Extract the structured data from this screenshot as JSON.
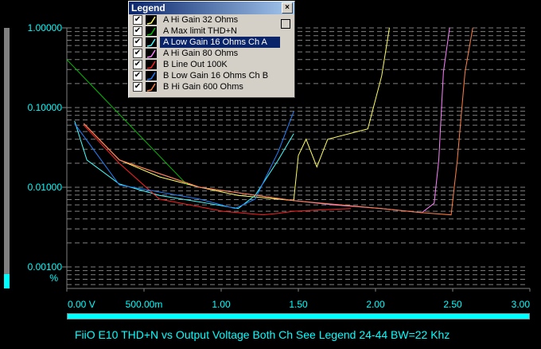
{
  "chart_data": {
    "type": "line",
    "title": "FiiO E10 THD+N vs Output Voltage Both Ch See Legend 24-44 BW=22 Khz",
    "xlabel": "V",
    "ylabel": "%",
    "xlim": [
      0,
      3
    ],
    "ylim": [
      0.00055,
      1
    ],
    "yscale": "log",
    "grid": true,
    "x_ticks": [
      "0.00 V",
      "500.00m",
      "1.00",
      "1.50",
      "2.00",
      "2.50",
      "3.00"
    ],
    "x_tick_values": [
      0,
      0.5,
      1,
      1.5,
      2,
      2.5,
      3
    ],
    "y_ticks": [
      "1.00000",
      "0.10000",
      "0.01000",
      "0.00100"
    ],
    "y_tick_values": [
      1,
      0.1,
      0.01,
      0.001
    ],
    "y_unit": "%",
    "series": [
      {
        "name": "A Hi Gain 32 Ohms",
        "color": "#ffff60",
        "points": [
          [
            0.11,
            0.063
          ],
          [
            0.34,
            0.022
          ],
          [
            0.6,
            0.0135
          ],
          [
            0.86,
            0.01
          ],
          [
            1.11,
            0.0079
          ],
          [
            1.47,
            0.0068
          ],
          [
            1.5,
            0.025
          ],
          [
            1.55,
            0.04
          ],
          [
            1.62,
            0.018
          ],
          [
            1.69,
            0.04
          ],
          [
            1.95,
            0.054
          ],
          [
            2.04,
            0.25
          ],
          [
            2.09,
            1.0
          ]
        ]
      },
      {
        "name": "A Max limit THD+N",
        "color": "#00c000",
        "points": [
          [
            0,
            0.4
          ],
          [
            0.78,
            0.0107
          ]
        ]
      },
      {
        "name": "A Low Gain 16 Ohms Ch A",
        "color": "#40ffff",
        "points": [
          [
            0.05,
            0.068
          ],
          [
            0.13,
            0.022
          ],
          [
            0.34,
            0.011
          ],
          [
            0.6,
            0.0079
          ],
          [
            0.91,
            0.0063
          ],
          [
            1.11,
            0.0054
          ],
          [
            1.22,
            0.0079
          ],
          [
            1.37,
            0.022
          ],
          [
            1.47,
            0.047
          ]
        ]
      },
      {
        "name": "A Hi Gain 80 Ohms",
        "color": "#ff80ff",
        "points": [
          [
            0.11,
            0.063
          ],
          [
            0.34,
            0.022
          ],
          [
            0.86,
            0.01
          ],
          [
            1.47,
            0.0068
          ],
          [
            1.73,
            0.006
          ],
          [
            2.04,
            0.0054
          ],
          [
            2.3,
            0.0048
          ],
          [
            2.38,
            0.0063
          ],
          [
            2.41,
            0.022
          ],
          [
            2.44,
            0.28
          ],
          [
            2.48,
            1.0
          ]
        ]
      },
      {
        "name": "B Line Out 100K",
        "color": "#ff2020",
        "points": [
          [
            0.11,
            0.06
          ],
          [
            0.34,
            0.02
          ],
          [
            0.6,
            0.0071
          ],
          [
            1.01,
            0.005
          ],
          [
            1.27,
            0.0045
          ],
          [
            1.37,
            0.0047
          ],
          [
            1.47,
            0.005
          ],
          [
            1.84,
            0.0054
          ]
        ]
      },
      {
        "name": "B Low Gain 16 Ohms Ch B",
        "color": "#2080ff",
        "points": [
          [
            0.05,
            0.063
          ],
          [
            0.34,
            0.0107
          ],
          [
            0.86,
            0.0071
          ],
          [
            1.09,
            0.0054
          ],
          [
            1.22,
            0.0071
          ],
          [
            1.37,
            0.028
          ],
          [
            1.47,
            0.089
          ]
        ]
      },
      {
        "name": "B Hi Gain 600 Ohms",
        "color": "#ff8040",
        "points": [
          [
            0.11,
            0.063
          ],
          [
            0.34,
            0.022
          ],
          [
            0.86,
            0.01
          ],
          [
            1.47,
            0.0068
          ],
          [
            2.04,
            0.0054
          ],
          [
            2.3,
            0.0048
          ],
          [
            2.49,
            0.0045
          ],
          [
            2.53,
            0.022
          ],
          [
            2.58,
            0.28
          ],
          [
            2.63,
            1.0
          ]
        ]
      }
    ]
  },
  "legend": {
    "title": "Legend",
    "close": "×",
    "selected_index": 2,
    "items": [
      {
        "ch": "A",
        "label": "Hi Gain 32 Ohms"
      },
      {
        "ch": "A",
        "label": "Max limit THD+N"
      },
      {
        "ch": "A",
        "label": "Low Gain 16 Ohms Ch A"
      },
      {
        "ch": "A",
        "label": "Hi Gain 80 Ohms"
      },
      {
        "ch": "B",
        "label": "Line Out 100K"
      },
      {
        "ch": "B",
        "label": "Low Gain 16 Ohms Ch B"
      },
      {
        "ch": "B",
        "label": "Hi Gain 600 Ohms"
      }
    ],
    "check": "✔"
  },
  "colors": {
    "axis_text": "#00ffff",
    "grid": "#808080"
  }
}
